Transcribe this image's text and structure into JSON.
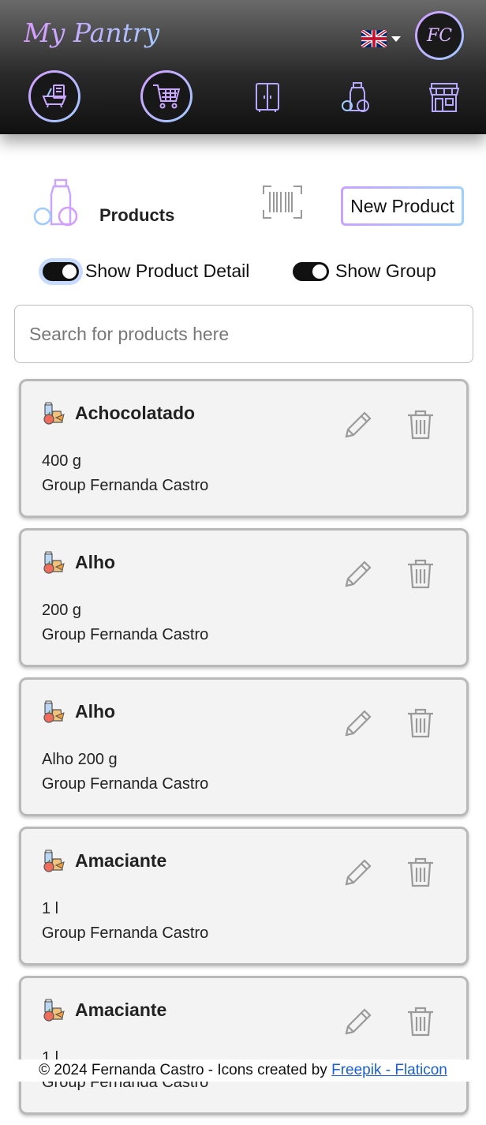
{
  "header": {
    "brand": "My Pantry",
    "avatar_initials": "FC",
    "language_icon": "uk-flag-icon",
    "nav_icons": [
      "pantry-icon",
      "cart-icon",
      "cupboard-icon",
      "products-icon",
      "store-icon"
    ]
  },
  "toolbar": {
    "title": "Products",
    "new_product_label": "New Product"
  },
  "toggles": {
    "show_detail_label": "Show Product Detail",
    "show_group_label": "Show Group"
  },
  "search": {
    "placeholder": "Search for products here"
  },
  "products": [
    {
      "name": "Achocolatado",
      "detail": "400 g",
      "group": "Group Fernanda Castro"
    },
    {
      "name": "Alho",
      "detail": "200 g",
      "group": "Group Fernanda Castro"
    },
    {
      "name": "Alho",
      "detail": "Alho 200 g",
      "group": "Group Fernanda Castro"
    },
    {
      "name": "Amaciante",
      "detail": "1 l",
      "group": "Group Fernanda Castro"
    },
    {
      "name": "Amaciante",
      "detail": "1 l",
      "group": "Group Fernanda Castro"
    }
  ],
  "footer": {
    "text": "© 2024 Fernanda Castro - Icons created by ",
    "link": "Freepik - Flaticon"
  },
  "colors": {
    "accent_purple": "#d59cff",
    "accent_blue": "#9ecbff",
    "link": "#1a5fd6"
  }
}
